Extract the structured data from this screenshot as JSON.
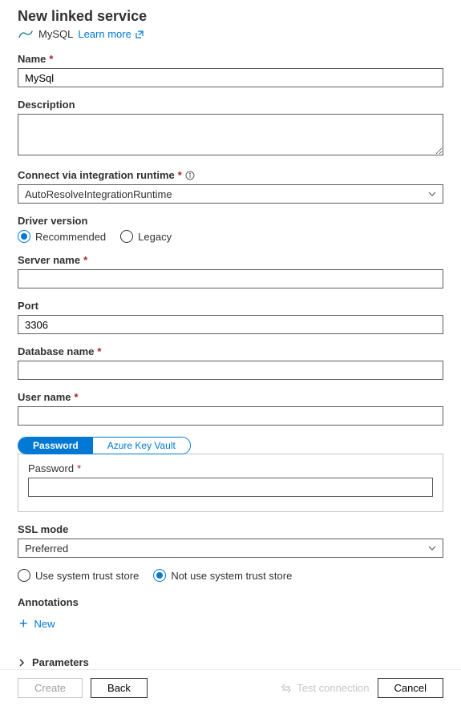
{
  "header": {
    "title": "New linked service",
    "connector_name": "MySQL",
    "learn_more_label": "Learn more"
  },
  "fields": {
    "name": {
      "label": "Name",
      "value": "MySql"
    },
    "description": {
      "label": "Description",
      "value": ""
    },
    "runtime": {
      "label": "Connect via integration runtime",
      "value": "AutoResolveIntegrationRuntime"
    },
    "driver": {
      "label": "Driver version",
      "recommended": "Recommended",
      "legacy": "Legacy",
      "selected": "recommended"
    },
    "server": {
      "label": "Server name",
      "value": ""
    },
    "port": {
      "label": "Port",
      "value": "3306"
    },
    "database": {
      "label": "Database name",
      "value": ""
    },
    "username": {
      "label": "User name",
      "value": ""
    },
    "auth_tabs": {
      "password": "Password",
      "keyvault": "Azure Key Vault",
      "selected": "password"
    },
    "password": {
      "label": "Password",
      "value": ""
    },
    "ssl": {
      "label": "SSL mode",
      "value": "Preferred"
    },
    "trust": {
      "use": "Use system trust store",
      "notuse": "Not use system trust store",
      "selected": "notuse"
    }
  },
  "annotations": {
    "title": "Annotations",
    "new_label": "New"
  },
  "parameters": {
    "title": "Parameters"
  },
  "footer": {
    "create": "Create",
    "back": "Back",
    "test": "Test connection",
    "cancel": "Cancel"
  }
}
